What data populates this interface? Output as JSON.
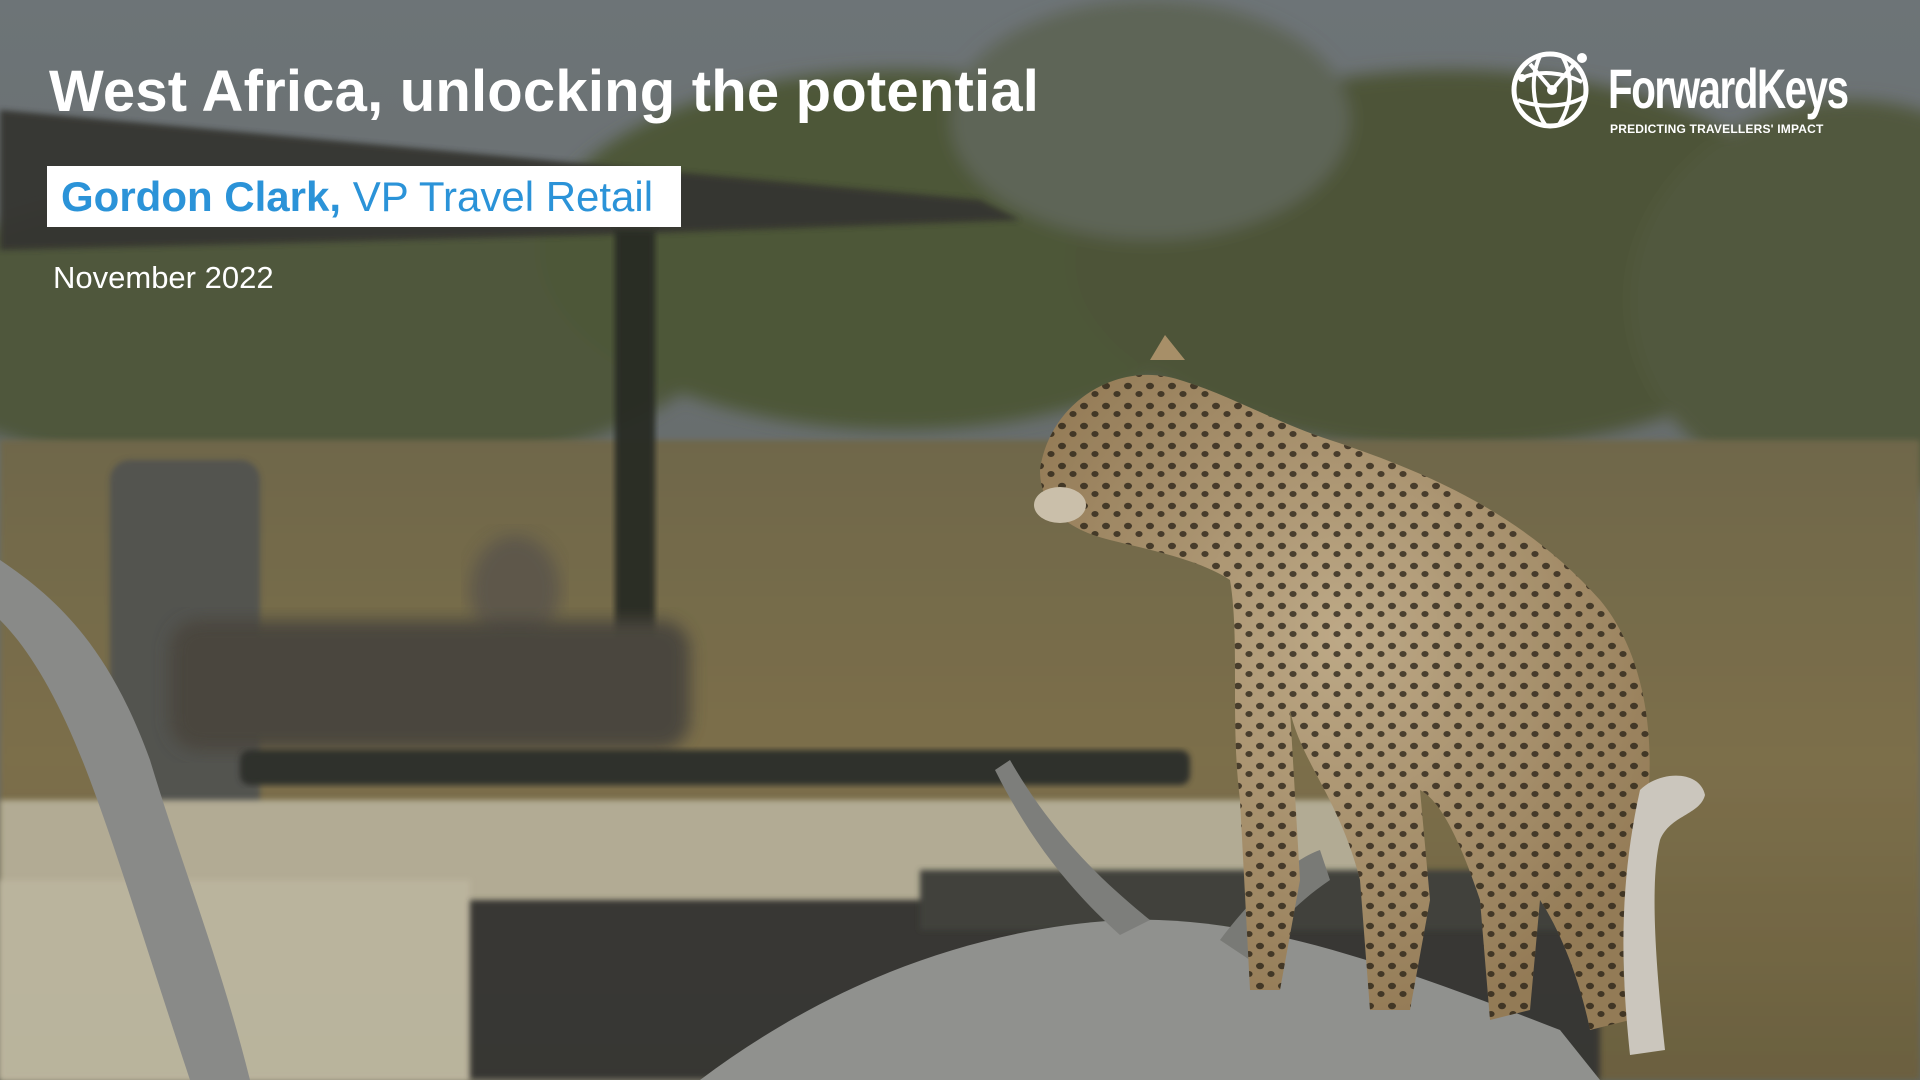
{
  "slide": {
    "title": "West Africa, unlocking the potential",
    "presenter": {
      "name": "Gordon Clark",
      "separator": ",",
      "role": " VP Travel Retail"
    },
    "date": "November 2022"
  },
  "logo": {
    "wordmark": "ForwardKeys",
    "tagline": "PREDICTING TRAVELLERS' IMPACT",
    "icon": "globe-icon"
  },
  "background": {
    "image": "leopard-on-log-safari-vehicle-photo",
    "colors": {
      "sky": "#7b8285",
      "grass": "#8e7f55",
      "trees": "#55603f",
      "vehicle": "#d6cfb6",
      "canopy": "#3a3a35",
      "log": "#a5a6a3",
      "leopard_fur": "#c2a57a",
      "leopard_spots": "#2c2418",
      "accent": "#2b93d8"
    }
  }
}
